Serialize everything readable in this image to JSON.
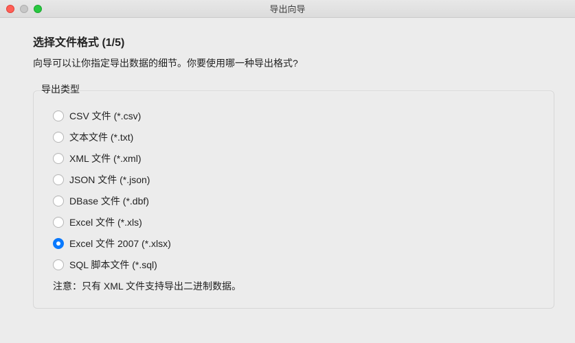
{
  "window": {
    "title": "导出向导"
  },
  "step": {
    "title": "选择文件格式 (1/5)",
    "description": "向导可以让你指定导出数据的细节。你要使用哪一种导出格式?"
  },
  "group": {
    "label": "导出类型",
    "note": "注意：只有 XML 文件支持导出二进制数据。"
  },
  "options": [
    {
      "label": "CSV 文件 (*.csv)",
      "selected": false
    },
    {
      "label": "文本文件 (*.txt)",
      "selected": false
    },
    {
      "label": "XML 文件 (*.xml)",
      "selected": false
    },
    {
      "label": "JSON 文件 (*.json)",
      "selected": false
    },
    {
      "label": "DBase 文件 (*.dbf)",
      "selected": false
    },
    {
      "label": "Excel 文件 (*.xls)",
      "selected": false
    },
    {
      "label": "Excel 文件 2007 (*.xlsx)",
      "selected": true
    },
    {
      "label": "SQL 脚本文件 (*.sql)",
      "selected": false
    }
  ]
}
